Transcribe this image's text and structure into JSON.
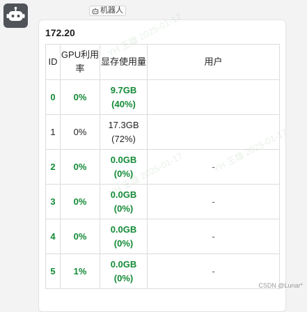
{
  "message": {
    "sender_name": "",
    "bot_tag_label": "机器人"
  },
  "card": {
    "title": "172.20",
    "table": {
      "headers": {
        "id": "ID",
        "gpu_util": "GPU利用率",
        "mem_used": "显存使用量",
        "user": "用户"
      },
      "rows": [
        {
          "id": "0",
          "gpu_util": "0%",
          "mem_used": "9.7GB (40%)",
          "user": "",
          "active": true
        },
        {
          "id": "1",
          "gpu_util": "0%",
          "mem_used": "17.3GB (72%)",
          "user": "",
          "active": false
        },
        {
          "id": "2",
          "gpu_util": "0%",
          "mem_used": "0.0GB (0%)",
          "user": "-",
          "active": true
        },
        {
          "id": "3",
          "gpu_util": "0%",
          "mem_used": "0.0GB (0%)",
          "user": "-",
          "active": true
        },
        {
          "id": "4",
          "gpu_util": "0%",
          "mem_used": "0.0GB (0%)",
          "user": "-",
          "active": true
        },
        {
          "id": "5",
          "gpu_util": "1%",
          "mem_used": "0.0GB (0%)",
          "user": "-",
          "active": true
        }
      ]
    }
  },
  "watermark_text": "YH 王雄 2025-01-17",
  "footer_credit": "CSDN @Lunar*",
  "colors": {
    "active_text": "#138a36",
    "avatar_bg": "#505358"
  },
  "icons": {
    "avatar": "robot-icon",
    "bot_tag": "robot-outline-icon"
  }
}
